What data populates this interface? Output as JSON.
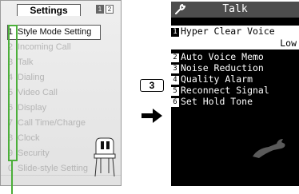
{
  "left_screen": {
    "title": "Settings",
    "page_indicator": [
      "1",
      "2"
    ],
    "menu": [
      {
        "num": "1",
        "label": "Style Mode Setting",
        "selected": true
      },
      {
        "num": "2",
        "label": "Incoming Call"
      },
      {
        "num": "3",
        "label": "Talk"
      },
      {
        "num": "4",
        "label": "Dialing"
      },
      {
        "num": "5",
        "label": "Video Call"
      },
      {
        "num": "6",
        "label": "Display"
      },
      {
        "num": "7",
        "label": "Call Time/Charge"
      },
      {
        "num": "8",
        "label": "Clock"
      },
      {
        "num": "9",
        "label": "Security"
      },
      {
        "num": "0",
        "label": "Slide-style Setting"
      }
    ]
  },
  "key_label": "3",
  "right_screen": {
    "title": "Talk",
    "items": [
      {
        "num": "1",
        "label": "Hyper Clear Voice",
        "value": "Low"
      },
      {
        "num": "2",
        "label": "Auto Voice Memo"
      },
      {
        "num": "3",
        "label": "Noise Reduction"
      },
      {
        "num": "4",
        "label": "Quality Alarm"
      },
      {
        "num": "5",
        "label": "Reconnect Signal"
      },
      {
        "num": "6",
        "label": "Set Hold Tone"
      }
    ]
  },
  "colors": {
    "highlight_green": "#4caf3a",
    "right_header_bg": "#4d4d4d",
    "right_bg": "#000000"
  }
}
